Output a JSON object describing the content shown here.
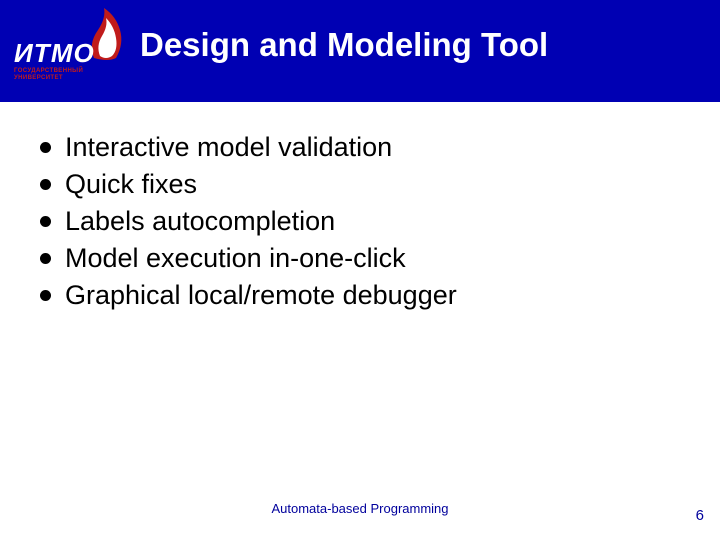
{
  "logo": {
    "main": "ИТМО",
    "sub_line1": "ГОСУДАРСТВЕННЫЙ",
    "sub_line2": "УНИВЕРСИТЕТ"
  },
  "title": "Design and Modeling Tool",
  "bullets": {
    "0": "Interactive model validation",
    "1": "Quick fixes",
    "2": "Labels autocompletion",
    "3": "Model execution in-one-click",
    "4": "Graphical local/remote debugger"
  },
  "footer": "Automata-based Programming",
  "page_number": "6"
}
